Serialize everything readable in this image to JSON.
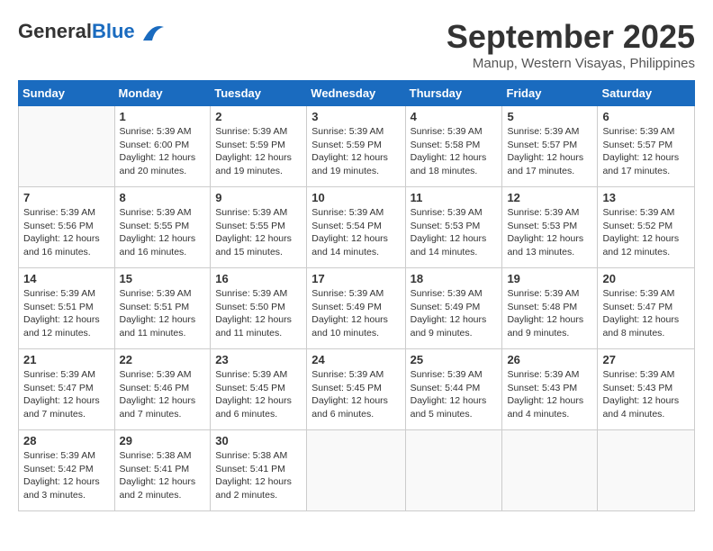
{
  "header": {
    "logo_general": "General",
    "logo_blue": "Blue",
    "month_title": "September 2025",
    "location": "Manup, Western Visayas, Philippines"
  },
  "days_of_week": [
    "Sunday",
    "Monday",
    "Tuesday",
    "Wednesday",
    "Thursday",
    "Friday",
    "Saturday"
  ],
  "weeks": [
    [
      {
        "day": "",
        "info": ""
      },
      {
        "day": "1",
        "info": "Sunrise: 5:39 AM\nSunset: 6:00 PM\nDaylight: 12 hours\nand 20 minutes."
      },
      {
        "day": "2",
        "info": "Sunrise: 5:39 AM\nSunset: 5:59 PM\nDaylight: 12 hours\nand 19 minutes."
      },
      {
        "day": "3",
        "info": "Sunrise: 5:39 AM\nSunset: 5:59 PM\nDaylight: 12 hours\nand 19 minutes."
      },
      {
        "day": "4",
        "info": "Sunrise: 5:39 AM\nSunset: 5:58 PM\nDaylight: 12 hours\nand 18 minutes."
      },
      {
        "day": "5",
        "info": "Sunrise: 5:39 AM\nSunset: 5:57 PM\nDaylight: 12 hours\nand 17 minutes."
      },
      {
        "day": "6",
        "info": "Sunrise: 5:39 AM\nSunset: 5:57 PM\nDaylight: 12 hours\nand 17 minutes."
      }
    ],
    [
      {
        "day": "7",
        "info": "Sunrise: 5:39 AM\nSunset: 5:56 PM\nDaylight: 12 hours\nand 16 minutes."
      },
      {
        "day": "8",
        "info": "Sunrise: 5:39 AM\nSunset: 5:55 PM\nDaylight: 12 hours\nand 16 minutes."
      },
      {
        "day": "9",
        "info": "Sunrise: 5:39 AM\nSunset: 5:55 PM\nDaylight: 12 hours\nand 15 minutes."
      },
      {
        "day": "10",
        "info": "Sunrise: 5:39 AM\nSunset: 5:54 PM\nDaylight: 12 hours\nand 14 minutes."
      },
      {
        "day": "11",
        "info": "Sunrise: 5:39 AM\nSunset: 5:53 PM\nDaylight: 12 hours\nand 14 minutes."
      },
      {
        "day": "12",
        "info": "Sunrise: 5:39 AM\nSunset: 5:53 PM\nDaylight: 12 hours\nand 13 minutes."
      },
      {
        "day": "13",
        "info": "Sunrise: 5:39 AM\nSunset: 5:52 PM\nDaylight: 12 hours\nand 12 minutes."
      }
    ],
    [
      {
        "day": "14",
        "info": "Sunrise: 5:39 AM\nSunset: 5:51 PM\nDaylight: 12 hours\nand 12 minutes."
      },
      {
        "day": "15",
        "info": "Sunrise: 5:39 AM\nSunset: 5:51 PM\nDaylight: 12 hours\nand 11 minutes."
      },
      {
        "day": "16",
        "info": "Sunrise: 5:39 AM\nSunset: 5:50 PM\nDaylight: 12 hours\nand 11 minutes."
      },
      {
        "day": "17",
        "info": "Sunrise: 5:39 AM\nSunset: 5:49 PM\nDaylight: 12 hours\nand 10 minutes."
      },
      {
        "day": "18",
        "info": "Sunrise: 5:39 AM\nSunset: 5:49 PM\nDaylight: 12 hours\nand 9 minutes."
      },
      {
        "day": "19",
        "info": "Sunrise: 5:39 AM\nSunset: 5:48 PM\nDaylight: 12 hours\nand 9 minutes."
      },
      {
        "day": "20",
        "info": "Sunrise: 5:39 AM\nSunset: 5:47 PM\nDaylight: 12 hours\nand 8 minutes."
      }
    ],
    [
      {
        "day": "21",
        "info": "Sunrise: 5:39 AM\nSunset: 5:47 PM\nDaylight: 12 hours\nand 7 minutes."
      },
      {
        "day": "22",
        "info": "Sunrise: 5:39 AM\nSunset: 5:46 PM\nDaylight: 12 hours\nand 7 minutes."
      },
      {
        "day": "23",
        "info": "Sunrise: 5:39 AM\nSunset: 5:45 PM\nDaylight: 12 hours\nand 6 minutes."
      },
      {
        "day": "24",
        "info": "Sunrise: 5:39 AM\nSunset: 5:45 PM\nDaylight: 12 hours\nand 6 minutes."
      },
      {
        "day": "25",
        "info": "Sunrise: 5:39 AM\nSunset: 5:44 PM\nDaylight: 12 hours\nand 5 minutes."
      },
      {
        "day": "26",
        "info": "Sunrise: 5:39 AM\nSunset: 5:43 PM\nDaylight: 12 hours\nand 4 minutes."
      },
      {
        "day": "27",
        "info": "Sunrise: 5:39 AM\nSunset: 5:43 PM\nDaylight: 12 hours\nand 4 minutes."
      }
    ],
    [
      {
        "day": "28",
        "info": "Sunrise: 5:39 AM\nSunset: 5:42 PM\nDaylight: 12 hours\nand 3 minutes."
      },
      {
        "day": "29",
        "info": "Sunrise: 5:38 AM\nSunset: 5:41 PM\nDaylight: 12 hours\nand 2 minutes."
      },
      {
        "day": "30",
        "info": "Sunrise: 5:38 AM\nSunset: 5:41 PM\nDaylight: 12 hours\nand 2 minutes."
      },
      {
        "day": "",
        "info": ""
      },
      {
        "day": "",
        "info": ""
      },
      {
        "day": "",
        "info": ""
      },
      {
        "day": "",
        "info": ""
      }
    ]
  ]
}
